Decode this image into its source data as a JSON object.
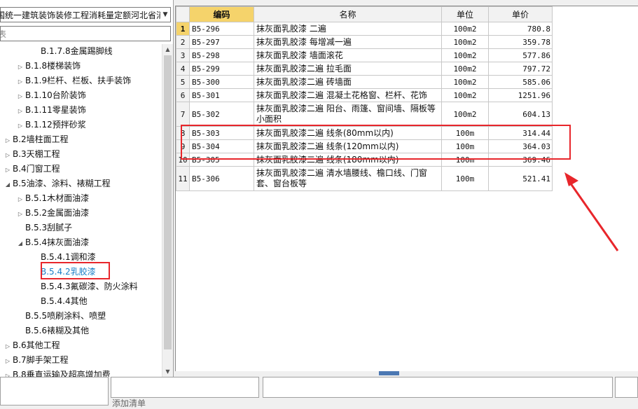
{
  "quota_library": {
    "value": "国统一建筑装饰装修工程消耗量定额河北省消",
    "arrow": "chevron-down-icon"
  },
  "tree_search": {
    "placeholder": "表"
  },
  "tree": [
    {
      "label": "B.1.7.8金属踢脚线",
      "toggle": ""
    },
    {
      "label": "B.1.8楼梯装饰",
      "toggle": "▷"
    },
    {
      "label": "B.1.9栏杆、栏板、扶手装饰",
      "toggle": "▷"
    },
    {
      "label": "B.1.10台阶装饰",
      "toggle": "▷"
    },
    {
      "label": "B.1.11零星装饰",
      "toggle": "▷"
    },
    {
      "label": "B.1.12预拌砂浆",
      "toggle": "▷"
    },
    {
      "label": "B.2墙柱面工程",
      "toggle": "▷"
    },
    {
      "label": "B.3天棚工程",
      "toggle": "▷"
    },
    {
      "label": "B.4门窗工程",
      "toggle": "▷"
    },
    {
      "label": "B.5油漆、涂料、裱糊工程",
      "toggle": "◢"
    },
    {
      "label": "B.5.1木材面油漆",
      "toggle": "▷"
    },
    {
      "label": "B.5.2金属面油漆",
      "toggle": "▷"
    },
    {
      "label": "B.5.3刮腻子",
      "toggle": ""
    },
    {
      "label": "B.5.4抹灰面油漆",
      "toggle": "◢"
    },
    {
      "label": "B.5.4.1调和漆",
      "toggle": ""
    },
    {
      "label": "B.5.4.2乳胶漆",
      "toggle": "",
      "selected": true
    },
    {
      "label": "B.5.4.3氟碳漆、防火涂料",
      "toggle": ""
    },
    {
      "label": "B.5.4.4其他",
      "toggle": ""
    },
    {
      "label": "B.5.5喷刷涂料、喷塑",
      "toggle": ""
    },
    {
      "label": "B.5.6裱糊及其他",
      "toggle": ""
    },
    {
      "label": "B.6其他工程",
      "toggle": "▷"
    },
    {
      "label": "B.7脚手架工程",
      "toggle": "▷"
    },
    {
      "label": "B.8垂直运输及超高增加费",
      "toggle": "▷"
    }
  ],
  "grid": {
    "headers": {
      "code": "编码",
      "name": "名称",
      "unit": "单位",
      "price": "单价"
    },
    "rows": [
      {
        "num": "1",
        "code": "B5-296",
        "name": "抹灰面乳胶漆 二遍",
        "unit": "100m2",
        "price": "780.8"
      },
      {
        "num": "2",
        "code": "B5-297",
        "name": "抹灰面乳胶漆 每增减一遍",
        "unit": "100m2",
        "price": "359.78"
      },
      {
        "num": "3",
        "code": "B5-298",
        "name": "抹灰面乳胶漆 墙面滚花",
        "unit": "100m2",
        "price": "577.86"
      },
      {
        "num": "4",
        "code": "B5-299",
        "name": "抹灰面乳胶漆二遍 拉毛面",
        "unit": "100m2",
        "price": "797.72"
      },
      {
        "num": "5",
        "code": "B5-300",
        "name": "抹灰面乳胶漆二遍 砖墙面",
        "unit": "100m2",
        "price": "585.06"
      },
      {
        "num": "6",
        "code": "B5-301",
        "name": "抹灰面乳胶漆二遍 混凝土花格窗、栏杆、花饰",
        "unit": "100m2",
        "price": "1251.96"
      },
      {
        "num": "7",
        "code": "B5-302",
        "name": "抹灰面乳胶漆二遍 阳台、雨篷、窗间墙、隔板等小面积",
        "unit": "100m2",
        "price": "604.13"
      },
      {
        "num": "8",
        "code": "B5-303",
        "name": "抹灰面乳胶漆二遍 线条(80mm以内)",
        "unit": "100m",
        "price": "314.44"
      },
      {
        "num": "9",
        "code": "B5-304",
        "name": "抹灰面乳胶漆二遍 线条(120mm以内)",
        "unit": "100m",
        "price": "364.03"
      },
      {
        "num": "10",
        "code": "B5-305",
        "name": "抹灰面乳胶漆二遍 线条(180mm以内)",
        "unit": "100m",
        "price": "369.46"
      },
      {
        "num": "11",
        "code": "B5-306",
        "name": "抹灰面乳胶漆二遍 清水墙腰线、檐口线、门窗套、窗台板等",
        "unit": "100m",
        "price": "521.41"
      }
    ]
  },
  "bottom": {
    "add_list_label": "添加清单"
  },
  "colors": {
    "highlight_red": "#e8262b",
    "header_active": "#f5d36b",
    "selected_link": "#1a7fc6"
  }
}
